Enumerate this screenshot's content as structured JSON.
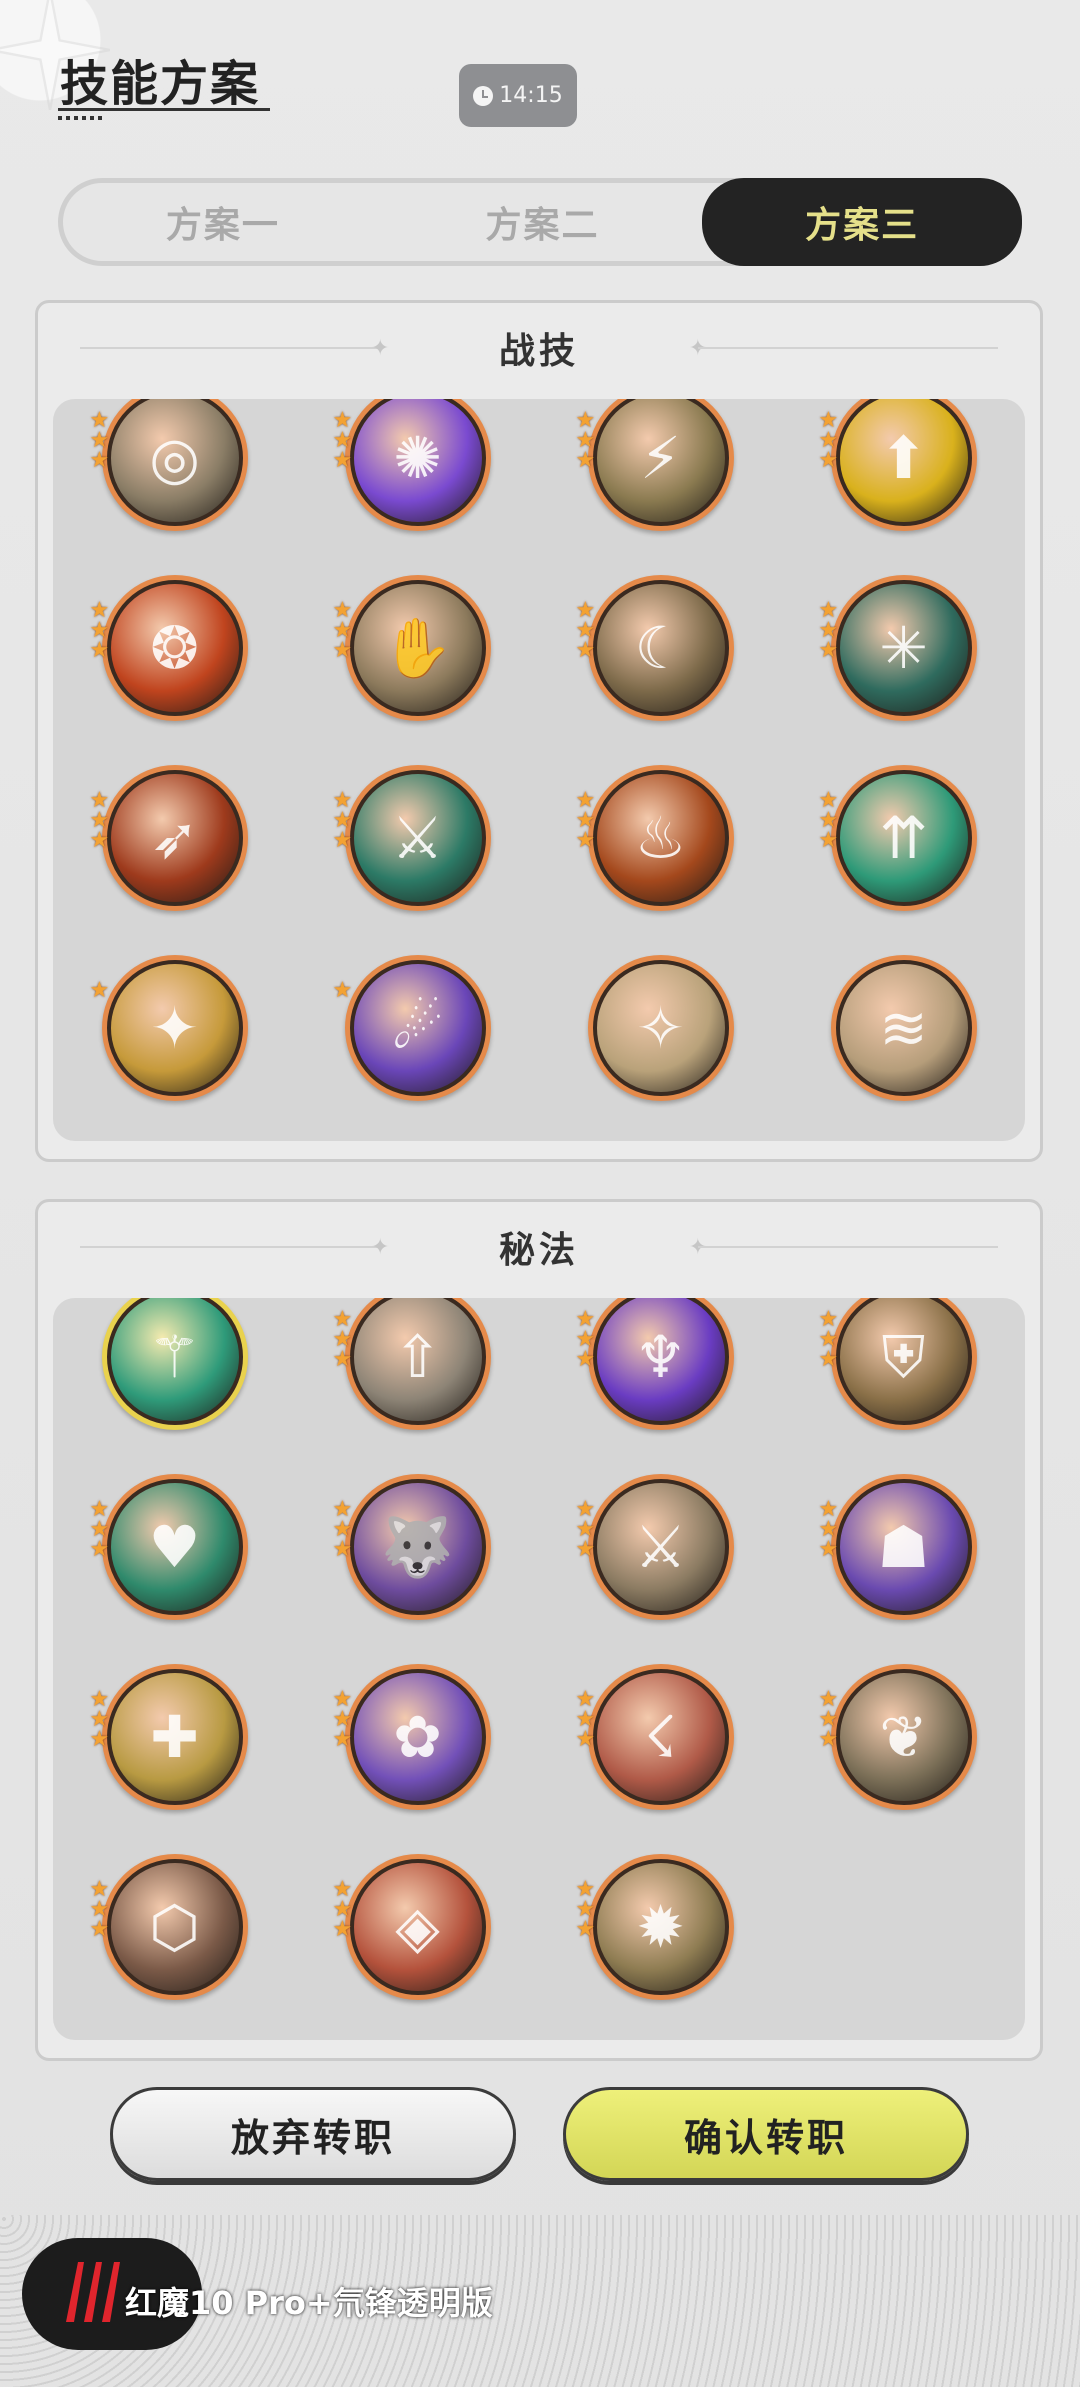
{
  "header": {
    "title": "技能方案",
    "clock": "14:15"
  },
  "tabs": [
    {
      "label": "方案一",
      "active": false
    },
    {
      "label": "方案二",
      "active": false
    },
    {
      "label": "方案三",
      "active": true
    }
  ],
  "sections": [
    {
      "title": "战技",
      "skills": [
        {
          "icon": "whirl-slash-icon",
          "glyph": "◎",
          "color": "#8a7d66",
          "stars": 3
        },
        {
          "icon": "purple-flame-icon",
          "glyph": "✺",
          "color": "#7a4ad0",
          "stars": 3
        },
        {
          "icon": "lightning-slash-icon",
          "glyph": "⚡",
          "color": "#8a7a50",
          "stars": 3
        },
        {
          "icon": "golden-shield-buff-icon",
          "glyph": "⬆",
          "color": "#d9b11c",
          "stars": 3
        },
        {
          "icon": "fire-crest-icon",
          "glyph": "❂",
          "color": "#c0441e",
          "stars": 3
        },
        {
          "icon": "claw-strike-icon",
          "glyph": "✋",
          "color": "#8c7a5c",
          "stars": 3
        },
        {
          "icon": "crescent-blade-icon",
          "glyph": "☾",
          "color": "#7d6a4a",
          "stars": 3
        },
        {
          "icon": "spider-web-icon",
          "glyph": "✳",
          "color": "#2f6b5e",
          "stars": 3
        },
        {
          "icon": "fire-slash-icon",
          "glyph": "➶",
          "color": "#9e3a1c",
          "stars": 3
        },
        {
          "icon": "emerald-sword-icon",
          "glyph": "⚔",
          "color": "#2c7a66",
          "stars": 3
        },
        {
          "icon": "flame-burst-icon",
          "glyph": "♨",
          "color": "#a4481c",
          "stars": 3
        },
        {
          "icon": "green-arrows-buff-icon",
          "glyph": "⇈",
          "color": "#2e9a78",
          "stars": 3
        },
        {
          "icon": "golden-swirl-icon",
          "glyph": "✦",
          "color": "#c69a3a",
          "stars": 1
        },
        {
          "icon": "shadow-claw-icon",
          "glyph": "☄",
          "color": "#6a46b8",
          "stars": 1
        },
        {
          "icon": "blade-burst-icon",
          "glyph": "✧",
          "color": "#b9a27a",
          "stars": 0
        },
        {
          "icon": "wind-slash-icon",
          "glyph": "≋",
          "color": "#b59d7a",
          "stars": 0
        }
      ]
    },
    {
      "title": "秘法",
      "skills": [
        {
          "icon": "jade-blade-icon",
          "glyph": "⚚",
          "color": "#2f9b7a",
          "stars": 0,
          "gold": true
        },
        {
          "icon": "sword-pedestal-icon",
          "glyph": "⇧",
          "color": "#8d8476",
          "stars": 3
        },
        {
          "icon": "violet-fire-icon",
          "glyph": "♆",
          "color": "#6a3cc2",
          "stars": 3
        },
        {
          "icon": "golden-armor-icon",
          "glyph": "⛨",
          "color": "#8a7048",
          "stars": 3
        },
        {
          "icon": "heal-heart-icon",
          "glyph": "♥",
          "color": "#2f8a6c",
          "stars": 3
        },
        {
          "icon": "beast-charge-icon",
          "glyph": "🐺",
          "color": "#6e4c9e",
          "stars": 3
        },
        {
          "icon": "sword-up-icon",
          "glyph": "⚔",
          "color": "#8b7b62",
          "stars": 3
        },
        {
          "icon": "spirit-aura-icon",
          "glyph": "☗",
          "color": "#6a4ab0",
          "stars": 3
        },
        {
          "icon": "golden-heal-icon",
          "glyph": "✚",
          "color": "#b89a42",
          "stars": 3
        },
        {
          "icon": "arcane-orb-icon",
          "glyph": "✿",
          "color": "#7250b8",
          "stars": 3
        },
        {
          "icon": "crimson-strike-icon",
          "glyph": "☇",
          "color": "#b05a48",
          "stars": 3
        },
        {
          "icon": "lotus-moon-icon",
          "glyph": "❦",
          "color": "#7c7058",
          "stars": 3
        },
        {
          "icon": "heart-shield-icon",
          "glyph": "⬡",
          "color": "#7b5a48",
          "stars": 3
        },
        {
          "icon": "shattered-rock-icon",
          "glyph": "◈",
          "color": "#b4523c",
          "stars": 3
        },
        {
          "icon": "vortex-target-icon",
          "glyph": "✹",
          "color": "#8e7c52",
          "stars": 3
        }
      ]
    }
  ],
  "buttons": {
    "cancel": "放弃转职",
    "confirm": "确认转职"
  },
  "watermark": {
    "text": "红魔10 Pro+氘锋透明版"
  },
  "colors": {
    "active_tab_bg": "#232323",
    "active_tab_text": "#e5e08a",
    "confirm_button": "#dfe164",
    "skill_ring": "#e58a4a"
  }
}
